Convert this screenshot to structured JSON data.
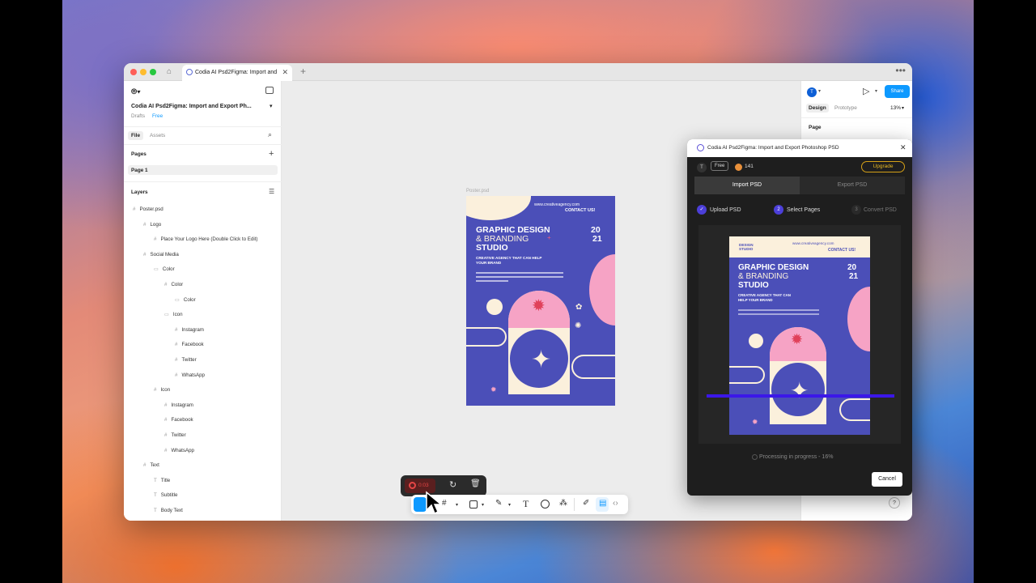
{
  "browser": {
    "tab_title": "Codia AI Psd2Figma: Import and",
    "tab_close": "✕",
    "new_tab": "+",
    "more": "•••"
  },
  "left_panel": {
    "file_title": "Codia AI Psd2Figma: Import and Export Ph...",
    "drafts": "Drafts",
    "plan": "Free",
    "tabs": [
      "File",
      "Assets"
    ],
    "pages_heading": "Pages",
    "pages": [
      "Page 1"
    ],
    "layers_heading": "Layers",
    "layers": [
      {
        "name": "Poster.psd",
        "indent": 0,
        "glyph": "#"
      },
      {
        "name": "Logo",
        "indent": 1,
        "glyph": "#"
      },
      {
        "name": "Place Your Logo Here (Double Click to Edit)",
        "indent": 2,
        "glyph": "#"
      },
      {
        "name": "Social Media",
        "indent": 1,
        "glyph": "#"
      },
      {
        "name": "Color",
        "indent": 2,
        "glyph": "▭"
      },
      {
        "name": "Color",
        "indent": 3,
        "glyph": "#"
      },
      {
        "name": "Color",
        "indent": 4,
        "glyph": "▭"
      },
      {
        "name": "Icon",
        "indent": 3,
        "glyph": "▭"
      },
      {
        "name": "Instagram",
        "indent": 4,
        "glyph": "#"
      },
      {
        "name": "Facebook",
        "indent": 4,
        "glyph": "#"
      },
      {
        "name": "Twitter",
        "indent": 4,
        "glyph": "#"
      },
      {
        "name": "WhatsApp",
        "indent": 4,
        "glyph": "#"
      },
      {
        "name": "Icon",
        "indent": 2,
        "glyph": "#"
      },
      {
        "name": "Instagram",
        "indent": 3,
        "glyph": "#"
      },
      {
        "name": "Facebook",
        "indent": 3,
        "glyph": "#"
      },
      {
        "name": "Twitter",
        "indent": 3,
        "glyph": "#"
      },
      {
        "name": "WhatsApp",
        "indent": 3,
        "glyph": "#"
      },
      {
        "name": "Text",
        "indent": 1,
        "glyph": "#"
      },
      {
        "name": "Title",
        "indent": 2,
        "glyph": "T"
      },
      {
        "name": "Subtitle",
        "indent": 2,
        "glyph": "T"
      },
      {
        "name": "Body Text",
        "indent": 2,
        "glyph": "T"
      }
    ]
  },
  "canvas": {
    "frame_label": "Poster.psd"
  },
  "poster": {
    "website": "www.creativeagency.com",
    "contact": "CONTACT US!",
    "title_line1": "GRAPHIC DESIGN",
    "title_line2": "& BRANDING",
    "title_line3": "STUDIO",
    "year_top": "20",
    "year_bottom": "21",
    "tagline": "CREATIVE AGENCY THAT CAN HELP YOUR BRAND",
    "logo_text": "DESIGN STUDIO"
  },
  "right_panel": {
    "avatar_initial": "T",
    "share": "Share",
    "tabs": [
      "Design",
      "Prototype"
    ],
    "zoom": "13%",
    "page_heading": "Page",
    "help": "?"
  },
  "plugin": {
    "title": "Codia AI Psd2Figma: Import and Export Photoshop PSD",
    "user_initial": "T",
    "plan": "Free",
    "credits": "141",
    "upgrade": "Upgrade",
    "tabs": [
      "Import PSD",
      "Export PSD"
    ],
    "steps": [
      {
        "num": "✓",
        "label": "Upload PSD"
      },
      {
        "num": "2",
        "label": "Select Pages"
      },
      {
        "num": "3",
        "label": "Convert PSD"
      }
    ],
    "progress_text": "Processing in progress - 16%",
    "progress_value": 0.16,
    "cancel": "Cancel"
  },
  "recording": {
    "time": "0:03"
  },
  "colors": {
    "poster_blue": "#4b4fb8",
    "poster_pink": "#f6a3c5",
    "poster_cream": "#fbf0dc",
    "accent": "#0d99ff",
    "plugin_bg": "#1e1e1e"
  }
}
